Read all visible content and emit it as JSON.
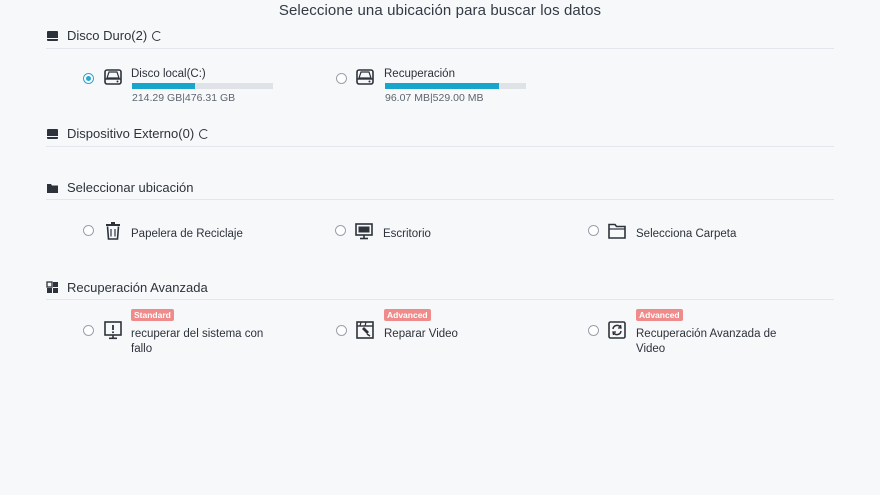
{
  "title": "Seleccione una ubicación para buscar los datos",
  "sections": {
    "hard_disk": {
      "label": "Disco Duro(2)",
      "icon": "hard-drive-icon"
    },
    "external": {
      "label": "Dispositivo Externo(0)",
      "icon": "external-drive-icon"
    },
    "location": {
      "label": "Seleccionar ubicación",
      "icon": "folder-icon"
    },
    "advanced": {
      "label": "Recuperación Avanzada",
      "icon": "grid-icon"
    }
  },
  "disks": [
    {
      "name": "Disco local(C:)",
      "size": "214.29 GB|476.31 GB",
      "used_fraction": 0.45,
      "selected": true
    },
    {
      "name": "Recuperación",
      "size": "96.07 MB|529.00 MB",
      "used_fraction": 0.81,
      "selected": false
    }
  ],
  "locations": [
    {
      "label": "Papelera de Reciclaje",
      "icon": "recycle-bin-icon"
    },
    {
      "label": "Escritorio",
      "icon": "desktop-icon"
    },
    {
      "label": "Selecciona Carpeta",
      "icon": "folder-icon"
    }
  ],
  "advanced_items": [
    {
      "badge": "Standard",
      "label_line1": "recuperar del sistema con",
      "label_line2": "fallo",
      "icon": "crash-system-icon"
    },
    {
      "badge": "Advanced",
      "label_line1": "Reparar Video",
      "label_line2": "",
      "icon": "video-repair-icon"
    },
    {
      "badge": "Advanced",
      "label_line1": "Recuperación Avanzada de",
      "label_line2": "Video",
      "icon": "advanced-video-icon"
    }
  ],
  "colors": {
    "accent": "#17a5cc",
    "badge": "#ef8b8b",
    "background": "#f7f8fa"
  }
}
